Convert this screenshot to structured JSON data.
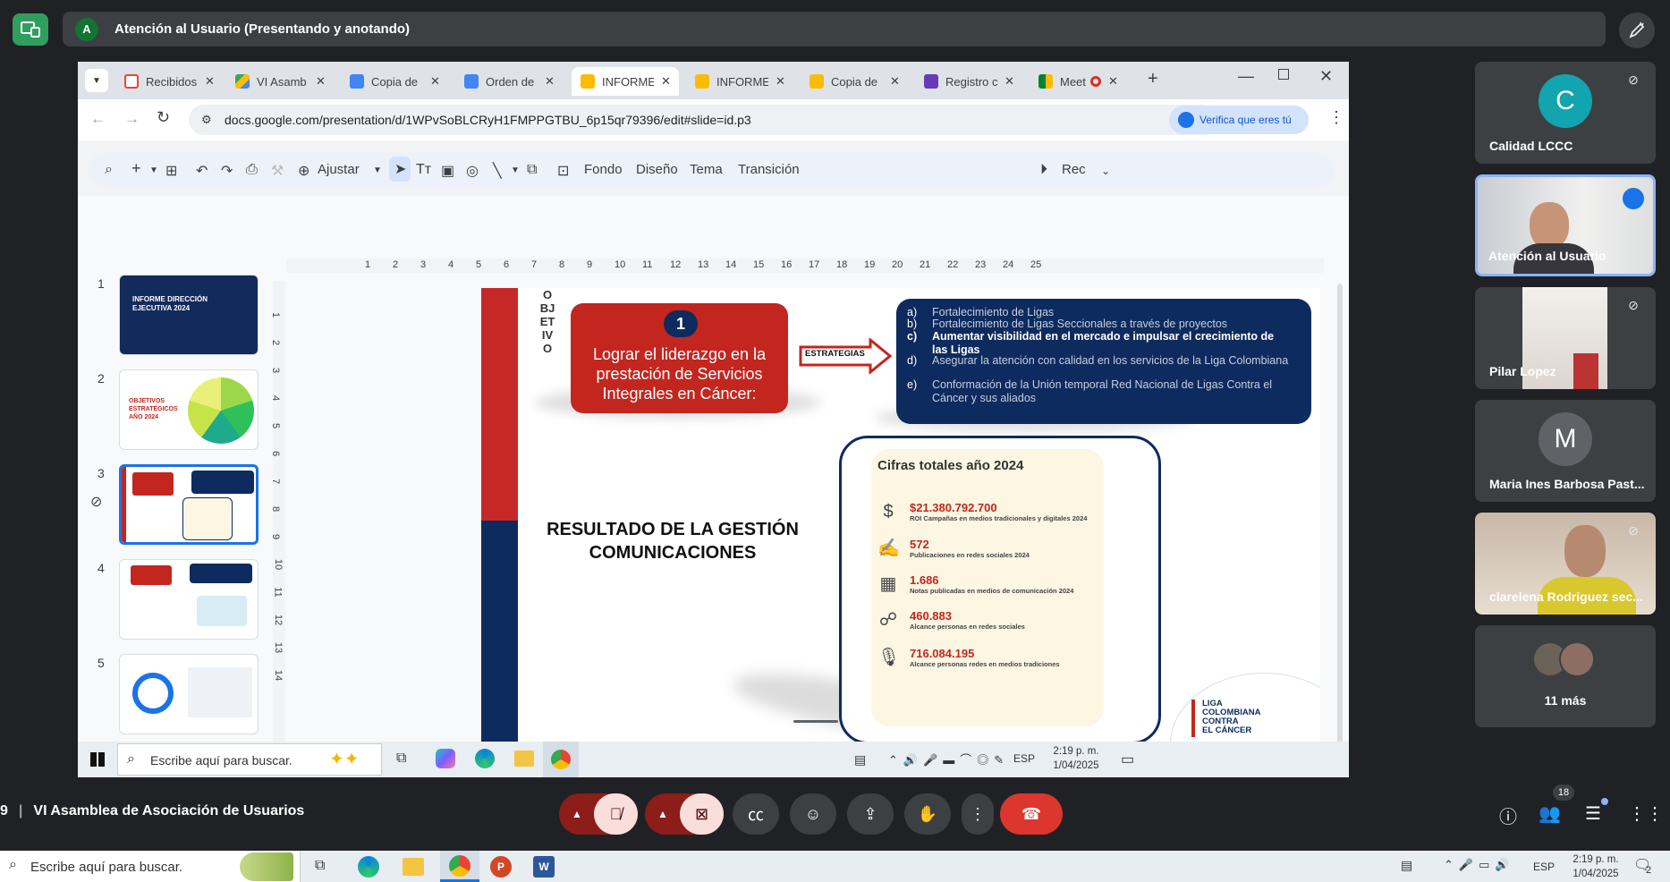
{
  "meet": {
    "presenter_initial": "A",
    "presenter_title": "Atención al Usuario (Presentando y anotando)",
    "meeting_code_fragment": "9",
    "meeting_title": "VI Asamblea de Asociación de Usuarios",
    "participants_count": "18"
  },
  "browser": {
    "tabs": [
      {
        "label": "Recibidos",
        "icon_color": "#ea4335",
        "icon": "gmail-icon"
      },
      {
        "label": "VI Asamb",
        "icon_color": "#fbbc04",
        "icon": "drive-icon"
      },
      {
        "label": "Copia de",
        "icon_color": "#4285f4",
        "icon": "docs-icon"
      },
      {
        "label": "Orden de",
        "icon_color": "#4285f4",
        "icon": "docs-icon"
      },
      {
        "label": "INFORME",
        "icon_color": "#fbbc04",
        "icon": "slides-icon",
        "active": true
      },
      {
        "label": "INFORME",
        "icon_color": "#fbbc04",
        "icon": "slides-icon"
      },
      {
        "label": "Copia de",
        "icon_color": "#fbbc04",
        "icon": "slides-icon"
      },
      {
        "label": "Registro c",
        "icon_color": "#673ab7",
        "icon": "forms-icon"
      },
      {
        "label": "Meet",
        "icon_color": "#00832d",
        "icon": "meet-icon"
      }
    ],
    "url": "docs.google.com/presentation/d/1WPvSoBLCRyH1FMPPGTBU_6p15qr79396/edit#slide=id.p3",
    "verify_label": "Verifica que eres tú"
  },
  "slides_toolbar": {
    "zoom_label": "Ajustar",
    "background_label": "Fondo",
    "design_label": "Diseño",
    "theme_label": "Tema",
    "transition_label": "Transición",
    "record_label": "Rec"
  },
  "filmstrip": {
    "numbers": [
      "1",
      "2",
      "3",
      "4",
      "5"
    ],
    "thumb1_title": "INFORME DIRECCIÓN EJECUTIVA 2024",
    "thumb2_title": "OBJETIVOS ESTRATÉGICOS AÑO 2024"
  },
  "ruler": {
    "top": [
      "1",
      "2",
      "3",
      "4",
      "5",
      "6",
      "7",
      "8",
      "9",
      "10",
      "11",
      "12",
      "13",
      "14",
      "15",
      "16",
      "17",
      "18",
      "19",
      "20",
      "21",
      "22",
      "23",
      "24",
      "25"
    ],
    "left": [
      "1",
      "2",
      "3",
      "4",
      "5",
      "6",
      "7",
      "8",
      "9",
      "10",
      "11",
      "12",
      "13",
      "14"
    ]
  },
  "slide": {
    "objective_vertical": [
      "O",
      "BJ",
      "ET",
      "IV",
      "O"
    ],
    "goal_number": "1",
    "goal_text": "Lograr el liderazgo en la prestación de Servicios Integrales en Cáncer:",
    "strategies_label": "ESTRATEGIAS",
    "strategies": [
      {
        "letter": "a)",
        "text": "Fortalecimiento de Ligas"
      },
      {
        "letter": "b)",
        "text": "Fortalecimiento de Ligas Seccionales a través de proyectos"
      },
      {
        "letter": "c)",
        "text": "Aumentar visibilidad en el mercado e impulsar el crecimiento de las Ligas"
      },
      {
        "letter": "d)",
        "text": "Asegurar la atención con calidad en los servicios de la Liga Colombiana"
      },
      {
        "letter": "e)",
        "text": "Conformación de la Unión temporal Red Nacional de Ligas Contra el Cáncer y sus aliados"
      }
    ],
    "result_title": "RESULTADO DE LA GESTIÓN COMUNICACIONES",
    "cifras_title": "Cifras totales año 2024",
    "metrics": [
      {
        "value": "$21.380.792.700",
        "desc": "ROI Campañas en medios tradicionales y digitales 2024",
        "icon": "$"
      },
      {
        "value": "572",
        "desc": "Publicaciones en redes sociales 2024",
        "icon": "✍"
      },
      {
        "value": "1.686",
        "desc": "Notas publicadas en medios de comunicación 2024",
        "icon": "▦"
      },
      {
        "value": "460.883",
        "desc": "Alcance personas en redes sociales",
        "icon": "☍"
      },
      {
        "value": "716.084.195",
        "desc": "Alcance personas redes en medios tradiciones",
        "icon": "🎙"
      }
    ],
    "logo_lines": [
      "LIGA",
      "COLOMBIANA",
      "CONTRA",
      "EL CÁNCER"
    ]
  },
  "share_taskbar": {
    "search_placeholder": "Escribe aquí para buscar.",
    "lang": "ESP",
    "time": "2:19 p. m.",
    "date": "1/04/2025"
  },
  "participants": [
    {
      "name": "Calidad LCCC",
      "initial": "C",
      "avatar_color": "#12a4af"
    },
    {
      "name": "Atención al Usuario"
    },
    {
      "name": "Pilar Lopez"
    },
    {
      "name": "Maria Ines Barbosa Past...",
      "initial": "M",
      "avatar_color": "#5f6368"
    },
    {
      "name": "clarelena Rodriguez sec..."
    },
    {
      "name": "11 más"
    }
  ],
  "os_taskbar": {
    "search_placeholder": "Escribe aquí para buscar.",
    "lang": "ESP",
    "time": "2:19 p. m.",
    "date": "1/04/2025",
    "notifications": "2"
  }
}
